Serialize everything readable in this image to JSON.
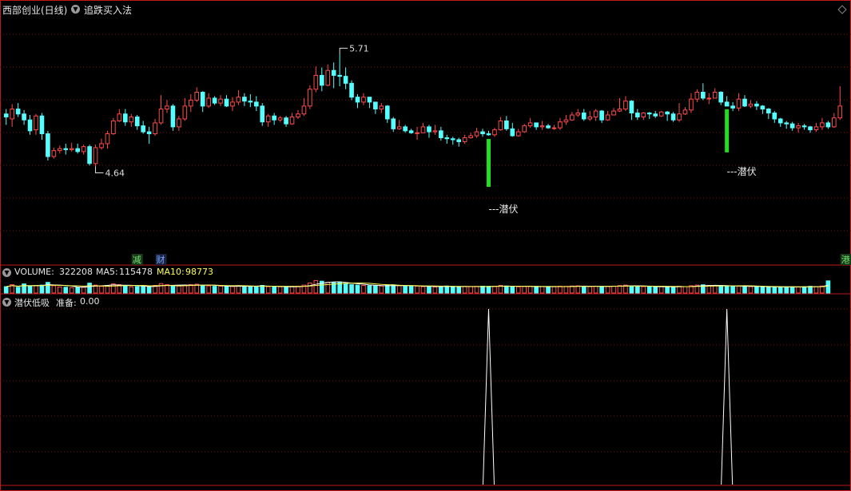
{
  "header": {
    "stock_title": "西部创业(日线)",
    "indicator_name": "追跌买入法"
  },
  "volume_panel": {
    "label": "VOLUME:",
    "value": "322208",
    "ma5_label": "MA5:",
    "ma5_value": "115478",
    "ma10_label": "MA10:",
    "ma10_value": "98773"
  },
  "signal_panel": {
    "label": "潜伏低吸",
    "ready_label": "准备:",
    "ready_value": "0.00"
  },
  "colors": {
    "up": "#ff4a4a",
    "down": "#54ffff",
    "signal_bar": "#22dd22",
    "ma5": "#ffffff",
    "ma10": "#ffff55",
    "grid": "#7a1010",
    "separator": "#c01818",
    "spike": "#ffffff"
  },
  "chart_data": {
    "type": "candlestick",
    "ylim": [
      3.6,
      6.1
    ],
    "price_high_label": "5.71",
    "price_low_label": "4.64",
    "signal_annotations": [
      {
        "text": "---潜伏",
        "candle_index": 81
      },
      {
        "text": "---潜伏",
        "candle_index": 121
      }
    ],
    "event_tags": [
      {
        "text": "减",
        "candle_index": 22,
        "color": "#6fe06f",
        "bg": "#1a3a1a"
      },
      {
        "text": "财",
        "candle_index": 26,
        "color": "#7aa6ff",
        "bg": "#1a2340"
      },
      {
        "text": "港",
        "candle_index": 141,
        "color": "#6fe06f",
        "bg": "#1a3a1a"
      }
    ],
    "spike_panel": {
      "ylim": [
        0,
        1
      ],
      "spikes": [
        {
          "candle_index": 81,
          "value": 1
        },
        {
          "candle_index": 121,
          "value": 1
        }
      ]
    },
    "candles": [
      [
        5.11,
        5.08,
        5.16,
        5.0
      ],
      [
        5.06,
        5.16,
        5.21,
        4.98
      ],
      [
        5.16,
        5.11,
        5.22,
        5.08
      ],
      [
        5.11,
        5.05,
        5.15,
        5.0
      ],
      [
        5.05,
        4.94,
        5.1,
        4.9
      ],
      [
        4.95,
        5.09,
        5.11,
        4.9
      ],
      [
        5.09,
        4.91,
        5.12,
        4.85
      ],
      [
        4.91,
        4.68,
        4.94,
        4.64
      ],
      [
        4.68,
        4.74,
        4.77,
        4.66
      ],
      [
        4.74,
        4.76,
        4.79,
        4.71
      ],
      [
        4.76,
        4.75,
        4.81,
        4.7
      ],
      [
        4.75,
        4.76,
        4.82,
        4.73
      ],
      [
        4.76,
        4.73,
        4.81,
        4.71
      ],
      [
        4.73,
        4.78,
        4.8,
        4.7
      ],
      [
        4.78,
        4.61,
        4.8,
        4.59
      ],
      [
        4.61,
        4.77,
        4.8,
        4.58
      ],
      [
        4.77,
        4.81,
        4.86,
        4.75
      ],
      [
        4.81,
        4.91,
        4.94,
        4.76
      ],
      [
        4.91,
        5.04,
        5.07,
        4.9
      ],
      [
        5.04,
        5.11,
        5.16,
        5.03
      ],
      [
        5.11,
        5.03,
        5.16,
        4.99
      ],
      [
        5.03,
        5.08,
        5.11,
        4.98
      ],
      [
        5.08,
        4.99,
        5.1,
        4.95
      ],
      [
        4.99,
        4.93,
        5.04,
        4.91
      ],
      [
        4.93,
        4.91,
        4.98,
        4.81
      ],
      [
        4.91,
        5.02,
        5.06,
        4.89
      ],
      [
        5.02,
        5.16,
        5.3,
        5.0
      ],
      [
        5.16,
        5.19,
        5.25,
        5.12
      ],
      [
        5.19,
        4.98,
        5.21,
        4.94
      ],
      [
        4.98,
        5.06,
        5.09,
        4.94
      ],
      [
        5.06,
        5.19,
        5.27,
        5.04
      ],
      [
        5.19,
        5.25,
        5.31,
        5.13
      ],
      [
        5.25,
        5.33,
        5.38,
        5.23
      ],
      [
        5.33,
        5.19,
        5.34,
        5.13
      ],
      [
        5.19,
        5.27,
        5.32,
        5.17
      ],
      [
        5.27,
        5.22,
        5.29,
        5.2
      ],
      [
        5.22,
        5.26,
        5.3,
        5.19
      ],
      [
        5.26,
        5.19,
        5.3,
        5.18
      ],
      [
        5.19,
        5.23,
        5.28,
        5.14
      ],
      [
        5.23,
        5.28,
        5.35,
        5.2
      ],
      [
        5.28,
        5.24,
        5.32,
        5.19
      ],
      [
        5.24,
        5.23,
        5.31,
        5.18
      ],
      [
        5.23,
        5.19,
        5.29,
        5.14
      ],
      [
        5.19,
        5.03,
        5.22,
        4.99
      ],
      [
        5.03,
        5.09,
        5.11,
        4.98
      ],
      [
        5.09,
        5.05,
        5.12,
        5.0
      ],
      [
        5.05,
        5.07,
        5.09,
        5.03
      ],
      [
        5.07,
        5.01,
        5.09,
        4.98
      ],
      [
        5.01,
        5.08,
        5.12,
        5.0
      ],
      [
        5.08,
        5.11,
        5.15,
        5.06
      ],
      [
        5.11,
        5.19,
        5.27,
        5.09
      ],
      [
        5.19,
        5.36,
        5.4,
        5.16
      ],
      [
        5.36,
        5.5,
        5.59,
        5.33
      ],
      [
        5.5,
        5.4,
        5.58,
        5.34
      ],
      [
        5.4,
        5.55,
        5.61,
        5.39
      ],
      [
        5.55,
        5.5,
        5.63,
        5.37
      ],
      [
        5.5,
        5.49,
        5.71,
        5.39
      ],
      [
        5.49,
        5.42,
        5.58,
        5.36
      ],
      [
        5.42,
        5.28,
        5.45,
        5.25
      ],
      [
        5.28,
        5.23,
        5.31,
        5.17
      ],
      [
        5.23,
        5.28,
        5.32,
        5.2
      ],
      [
        5.28,
        5.23,
        5.28,
        5.17
      ],
      [
        5.23,
        5.16,
        5.23,
        5.11
      ],
      [
        5.16,
        5.19,
        5.22,
        5.12
      ],
      [
        5.19,
        5.06,
        5.2,
        5.02
      ],
      [
        5.06,
        4.96,
        5.08,
        4.93
      ],
      [
        4.96,
        4.98,
        5.05,
        4.95
      ],
      [
        4.98,
        4.94,
        5.0,
        4.92
      ],
      [
        4.94,
        4.92,
        4.96,
        4.91
      ],
      [
        4.92,
        4.92,
        4.98,
        4.85
      ],
      [
        4.92,
        4.98,
        5.02,
        4.92
      ],
      [
        4.98,
        4.93,
        5.0,
        4.87
      ],
      [
        4.93,
        4.94,
        5.0,
        4.9
      ],
      [
        4.94,
        4.87,
        4.98,
        4.84
      ],
      [
        4.87,
        4.86,
        4.9,
        4.81
      ],
      [
        4.86,
        4.85,
        4.88,
        4.8
      ],
      [
        4.85,
        4.83,
        4.87,
        4.78
      ],
      [
        4.83,
        4.87,
        4.9,
        4.81
      ],
      [
        4.87,
        4.89,
        4.92,
        4.86
      ],
      [
        4.89,
        4.93,
        4.97,
        4.87
      ],
      [
        4.93,
        4.91,
        4.96,
        4.88
      ],
      [
        4.91,
        4.9,
        4.94,
        4.89
      ],
      [
        4.9,
        4.95,
        4.97,
        4.88
      ],
      [
        4.95,
        5.04,
        5.08,
        4.94
      ],
      [
        5.04,
        4.96,
        5.09,
        4.94
      ],
      [
        4.96,
        4.89,
        5.02,
        4.88
      ],
      [
        4.89,
        4.93,
        4.96,
        4.88
      ],
      [
        4.93,
        4.99,
        5.01,
        4.92
      ],
      [
        4.99,
        5.02,
        5.07,
        4.97
      ],
      [
        5.02,
        4.98,
        5.02,
        4.95
      ],
      [
        4.98,
        4.99,
        5.04,
        4.95
      ],
      [
        4.99,
        4.97,
        5.01,
        4.96
      ],
      [
        4.97,
        4.97,
        5.0,
        4.95
      ],
      [
        4.97,
        5.03,
        5.07,
        4.95
      ],
      [
        5.03,
        5.05,
        5.1,
        5.0
      ],
      [
        5.05,
        5.1,
        5.13,
        5.04
      ],
      [
        5.1,
        5.12,
        5.16,
        5.08
      ],
      [
        5.12,
        5.06,
        5.16,
        5.04
      ],
      [
        5.06,
        5.08,
        5.14,
        5.04
      ],
      [
        5.08,
        5.14,
        5.16,
        5.04
      ],
      [
        5.14,
        5.05,
        5.15,
        5.02
      ],
      [
        5.05,
        5.1,
        5.14,
        5.04
      ],
      [
        5.1,
        5.14,
        5.17,
        5.1
      ],
      [
        5.14,
        5.16,
        5.27,
        5.13
      ],
      [
        5.16,
        5.24,
        5.29,
        5.14
      ],
      [
        5.24,
        5.12,
        5.25,
        5.05
      ],
      [
        5.12,
        5.08,
        5.16,
        5.05
      ],
      [
        5.08,
        5.12,
        5.13,
        5.05
      ],
      [
        5.12,
        5.11,
        5.13,
        5.06
      ],
      [
        5.11,
        5.09,
        5.14,
        5.07
      ],
      [
        5.09,
        5.13,
        5.14,
        5.08
      ],
      [
        5.13,
        5.11,
        5.14,
        5.04
      ],
      [
        5.11,
        5.05,
        5.13,
        5.03
      ],
      [
        5.05,
        5.11,
        5.22,
        5.03
      ],
      [
        5.11,
        5.15,
        5.18,
        5.1
      ],
      [
        5.15,
        5.26,
        5.32,
        5.12
      ],
      [
        5.26,
        5.33,
        5.36,
        5.23
      ],
      [
        5.33,
        5.27,
        5.42,
        5.25
      ],
      [
        5.27,
        5.27,
        5.32,
        5.21
      ],
      [
        5.27,
        5.33,
        5.37,
        5.27
      ],
      [
        5.33,
        5.23,
        5.34,
        5.2
      ],
      [
        5.23,
        5.19,
        5.29,
        5.19
      ],
      [
        5.19,
        5.17,
        5.23,
        5.14
      ],
      [
        5.17,
        5.26,
        5.32,
        5.14
      ],
      [
        5.26,
        5.19,
        5.3,
        5.18
      ],
      [
        5.19,
        5.21,
        5.25,
        5.17
      ],
      [
        5.21,
        5.19,
        5.24,
        5.15
      ],
      [
        5.19,
        5.16,
        5.2,
        5.11
      ],
      [
        5.16,
        5.12,
        5.17,
        5.06
      ],
      [
        5.12,
        5.06,
        5.14,
        5.02
      ],
      [
        5.06,
        5.02,
        5.07,
        4.98
      ],
      [
        5.02,
        5.01,
        5.04,
        4.96
      ],
      [
        5.01,
        4.97,
        5.03,
        4.94
      ],
      [
        4.97,
        4.99,
        5.02,
        4.92
      ],
      [
        4.99,
        4.98,
        5.01,
        4.95
      ],
      [
        4.98,
        4.95,
        4.99,
        4.92
      ],
      [
        4.95,
        4.98,
        5.02,
        4.93
      ],
      [
        4.98,
        5.02,
        5.07,
        4.95
      ],
      [
        5.02,
        4.98,
        5.04,
        4.96
      ],
      [
        4.98,
        5.07,
        5.12,
        4.97
      ],
      [
        5.07,
        5.19,
        5.39,
        5.05
      ]
    ],
    "volume": [
      42,
      55,
      38,
      60,
      45,
      50,
      52,
      70,
      48,
      40,
      38,
      35,
      36,
      40,
      65,
      52,
      44,
      50,
      60,
      55,
      48,
      40,
      42,
      45,
      39,
      50,
      62,
      55,
      48,
      46,
      52,
      55,
      58,
      50,
      47,
      44,
      45,
      42,
      43,
      48,
      46,
      45,
      44,
      50,
      42,
      40,
      41,
      39,
      43,
      45,
      52,
      66,
      82,
      78,
      70,
      68,
      72,
      60,
      55,
      52,
      50,
      48,
      47,
      46,
      50,
      54,
      48,
      46,
      44,
      45,
      42,
      43,
      40,
      44,
      46,
      42,
      41,
      43,
      42,
      44,
      45,
      43,
      44,
      50,
      46,
      42,
      41,
      43,
      45,
      41,
      42,
      40,
      41,
      45,
      44,
      46,
      47,
      44,
      42,
      45,
      43,
      44,
      45,
      49,
      52,
      47,
      43,
      42,
      41,
      40,
      42,
      41,
      40,
      44,
      42,
      48,
      52,
      54,
      50,
      48,
      46,
      45,
      44,
      46,
      44,
      42,
      41,
      40,
      41,
      40,
      39,
      40,
      41,
      40,
      42,
      44,
      42,
      46,
      80
    ],
    "vol_scale_max": 100
  }
}
